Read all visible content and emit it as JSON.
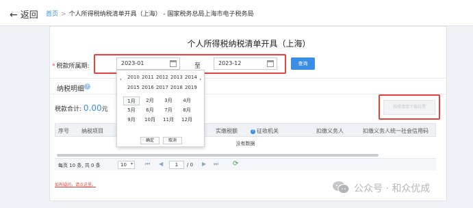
{
  "header": {
    "back_label": "返回",
    "breadcrumb": {
      "home": "首页",
      "sep": ">",
      "current": "个人所得税纳税清单开具（上海）",
      "site": "- 国家税务总局上海市电子税务局"
    }
  },
  "page_title": "个人所得税纳税清单开具（上海）",
  "filter": {
    "required_mark": "*",
    "label": "税款所属期:",
    "start_value": "2023-01",
    "to_label": "至",
    "end_value": "2023-12",
    "query_button": "查询"
  },
  "details": {
    "title": "纳税明细",
    "info_icon": "?",
    "total_label": "税款合计:",
    "total_amount": "0.00",
    "total_unit": "元",
    "download_button": "按照清单下载拉票"
  },
  "table": {
    "columns": [
      "序号",
      "纳税项目",
      "实缴税额",
      "征收机关",
      "扣缴义务人",
      "扣缴义务人统一社会信用码"
    ],
    "help_icon": "?",
    "empty_text": "没有数据"
  },
  "pager": {
    "info": "每页 10 条, 共 0 条",
    "page_size": "10",
    "dropdown": "▾",
    "first": "⏮",
    "prev": "◀",
    "page": "1",
    "of": "/ 0",
    "next": "▶",
    "last": "⏭",
    "refresh": "⟳"
  },
  "footnote": "如有疑问，请点这里。",
  "picker": {
    "prev": "‹",
    "next": "›",
    "years_row1": [
      "2010",
      "2011",
      "2012",
      "2013",
      "2014"
    ],
    "years_row2": [
      "2015",
      "2016",
      "2017",
      "2018",
      "2019"
    ],
    "months": [
      "1月",
      "2月",
      "3月",
      "4月",
      "5月",
      "6月",
      "7月",
      "8月",
      "9月",
      "10月",
      "11月",
      "12月"
    ],
    "selected_month": "1月",
    "ok": "确定",
    "cancel": "取消"
  },
  "watermark": {
    "text": "公众号 · 和众优成"
  },
  "colors": {
    "accent": "#3a8ee6",
    "highlight_box": "#e8403a"
  }
}
